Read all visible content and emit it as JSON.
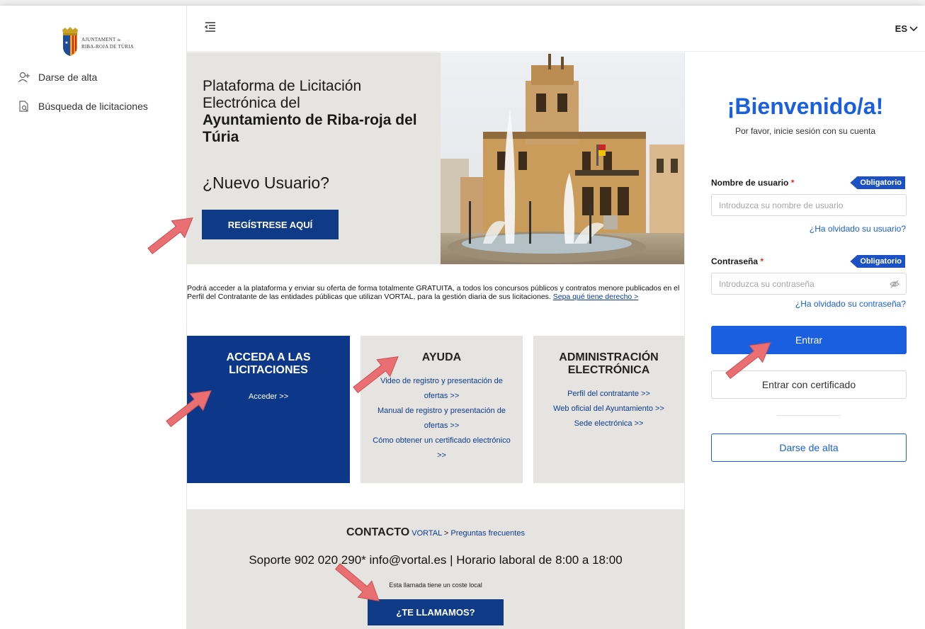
{
  "sidebar": {
    "logo_text_line1": "AJUNTAMENT",
    "logo_text_de": "de",
    "logo_text_line2": "RIBA-ROJA DE TÚRIA",
    "items": [
      {
        "label": "Darse de alta",
        "icon": "add-user-icon"
      },
      {
        "label": "Búsqueda de licitaciones",
        "icon": "document-search-icon"
      }
    ]
  },
  "topbar": {
    "language": "ES",
    "language_icon": "chevron-down-icon",
    "menu_icon": "menu-collapse-icon"
  },
  "hero": {
    "title_line1": "Plataforma de Licitación",
    "title_line2": "Electrónica del",
    "title_bold": "Ayuntamiento de Riba-roja del Túria",
    "new_user": "¿Nuevo Usuario?",
    "register_button": "REGÍSTRESE AQUÍ"
  },
  "intro": {
    "text": "Podrá acceder a la plataforma y enviar su oferta de forma totalmente GRATUITA, a todos los concursos públicos y contratos menore publicados en el Perfil del Contratante de las entidades públicas que utilizan VORTAL, para la gestión diaria de sus licitaciones.",
    "link": "Sepa qué tiene derecho >"
  },
  "cards": {
    "access": {
      "title": "ACCEDA A LAS LICITACIONES",
      "links": [
        "Acceder >>"
      ]
    },
    "help": {
      "title": "AYUDA",
      "links": [
        "Video de registro y presentación de ofertas >>",
        "Manual de registro y presentación de ofertas >>",
        "Cómo obtener un certificado electrónico >>"
      ]
    },
    "admin": {
      "title": "ADMINISTRACIÓN ELECTRÓNICA",
      "links": [
        "Perfil del contratante >>",
        "Web oficial del Ayuntamiento >>",
        "Sede electrónica >>"
      ]
    }
  },
  "contact": {
    "title": "CONTACTO",
    "vortal_link": "VORTAL",
    "faq_separator": ">",
    "faq_link": "Preguntas frecuentes",
    "support_line": "Soporte 902 020 290* info@vortal.es | Horario laboral de 8:00 a 18:00",
    "note": "Esta llamada tiene un coste local",
    "call_button": "¿TE LLAMAMOS?"
  },
  "login": {
    "welcome": "¡Bienvenido/a!",
    "subtitle": "Por favor, inicie sesión con su cuenta",
    "username_label": "Nombre de usuario",
    "password_label": "Contraseña",
    "required_mark": "*",
    "required_tag": "Obligatorio",
    "username_placeholder": "Introduzca su nombre de usuario",
    "password_placeholder": "Introduzca su contraseña",
    "forgot_username": "¿Ha olvidado su usuario?",
    "forgot_password": "¿Ha olvidado su contraseña?",
    "enter_button": "Entrar",
    "certificate_button": "Entrar con certificado",
    "signup_button": "Darse de alta"
  },
  "colors": {
    "brand_navy": "#0f3a86",
    "accent_blue": "#1a5fe0",
    "panel_grey": "#e6e4e0",
    "arrow_red": "#e8686c"
  }
}
